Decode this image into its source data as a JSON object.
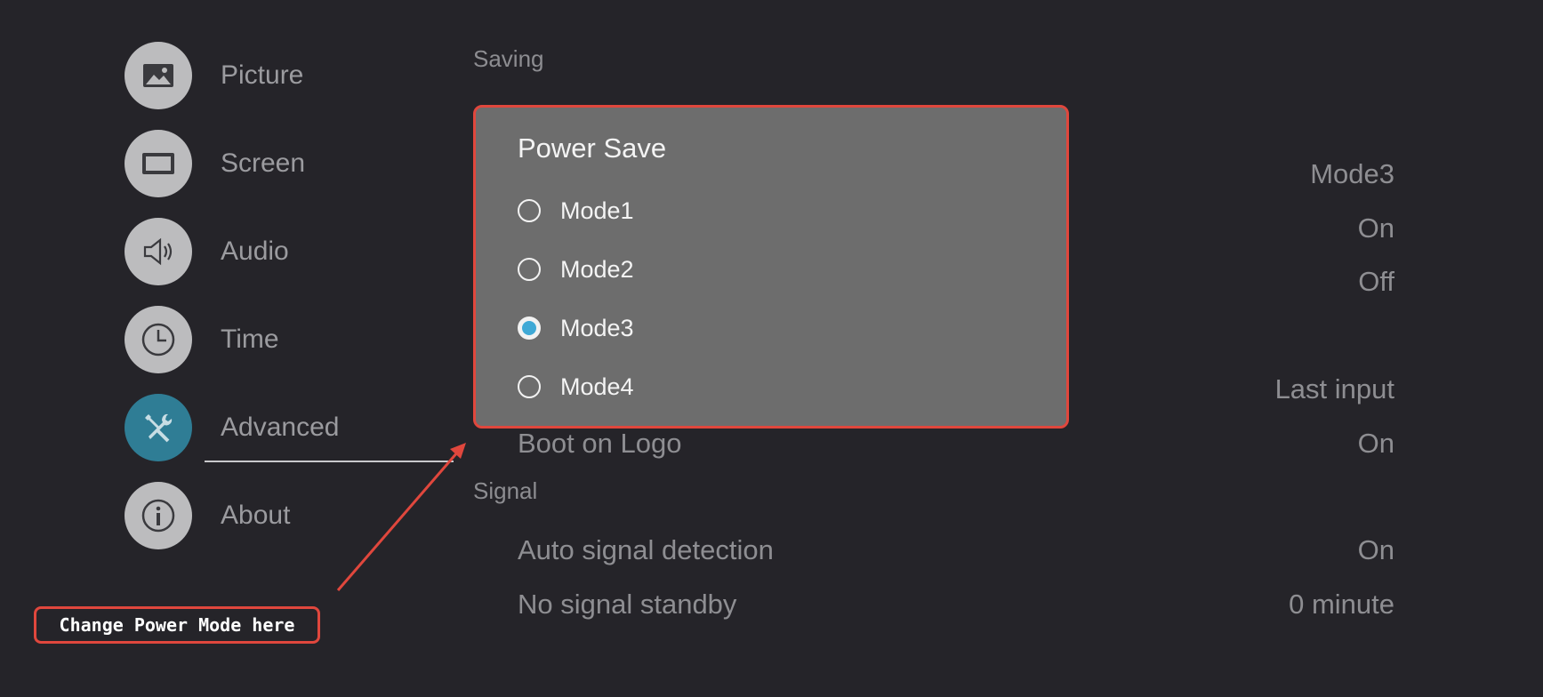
{
  "nav": [
    {
      "label": "Picture",
      "icon": "picture-icon"
    },
    {
      "label": "Screen",
      "icon": "screen-icon"
    },
    {
      "label": "Audio",
      "icon": "audio-icon"
    },
    {
      "label": "Time",
      "icon": "clock-icon"
    },
    {
      "label": "Advanced",
      "icon": "tools-icon",
      "active": true
    },
    {
      "label": "About",
      "icon": "info-icon"
    }
  ],
  "sections": {
    "saving": "Saving",
    "signal": "Signal"
  },
  "saving_values": [
    "Mode3",
    "On",
    "Off",
    "Last input"
  ],
  "boot_on_logo": {
    "label": "Boot on Logo",
    "value": "On"
  },
  "signal_rows": [
    {
      "label": "Auto signal detection",
      "value": "On"
    },
    {
      "label": "No signal standby",
      "value": "0 minute"
    }
  ],
  "dialog": {
    "title": "Power Save",
    "options": [
      "Mode1",
      "Mode2",
      "Mode3",
      "Mode4"
    ],
    "selected": "Mode3"
  },
  "callout": {
    "text": "Change Power Mode here"
  },
  "colors": {
    "accent": "#e0473d",
    "selected_radio": "#3fa9d6",
    "active_nav": "#2f7d95"
  }
}
